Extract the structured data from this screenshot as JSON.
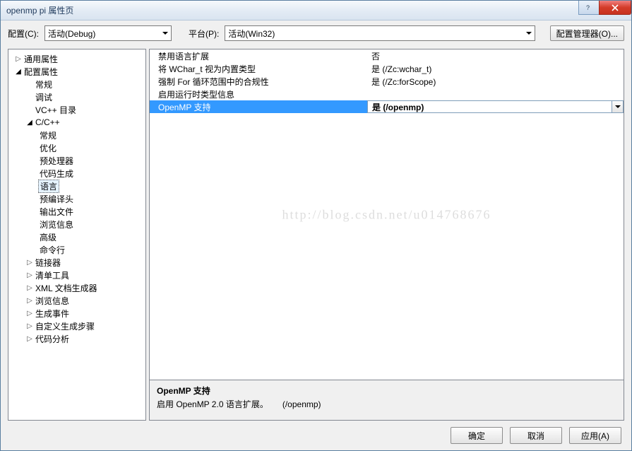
{
  "window": {
    "title": "openmp pi 属性页"
  },
  "toolbar": {
    "config_label": "配置(C):",
    "config_value": "活动(Debug)",
    "platform_label": "平台(P):",
    "platform_value": "活动(Win32)",
    "manager_button": "配置管理器(O)..."
  },
  "tree": {
    "general": "通用属性",
    "config_props": "配置属性",
    "cfg": {
      "general": "常规",
      "debug": "调试",
      "vcdirs": "VC++ 目录",
      "ccpp": "C/C++",
      "ccpp_children": {
        "general": "常规",
        "optimize": "优化",
        "preproc": "预处理器",
        "codegen": "代码生成",
        "language": "语言",
        "pch": "预编译头",
        "outfiles": "输出文件",
        "browse": "浏览信息",
        "advanced": "高级",
        "cmdline": "命令行"
      },
      "linker": "链接器",
      "manifest": "清单工具",
      "xmldoc": "XML 文档生成器",
      "browseinfo": "浏览信息",
      "buildevents": "生成事件",
      "custombuild": "自定义生成步骤",
      "codeanalysis": "代码分析"
    }
  },
  "grid": {
    "rows": [
      {
        "name": "禁用语言扩展",
        "value": "否"
      },
      {
        "name": "将 WChar_t 视为内置类型",
        "value": "是 (/Zc:wchar_t)"
      },
      {
        "name": "强制 For 循环范围中的合规性",
        "value": "是 (/Zc:forScope)"
      },
      {
        "name": "启用运行时类型信息",
        "value": ""
      },
      {
        "name": "OpenMP 支持",
        "value": "是 (/openmp)",
        "selected": true
      }
    ],
    "watermark": "http://blog.csdn.net/u014768676"
  },
  "desc": {
    "title": "OpenMP 支持",
    "text": "启用 OpenMP 2.0 语言扩展。",
    "switch": "(/openmp)"
  },
  "buttons": {
    "ok": "确定",
    "cancel": "取消",
    "apply": "应用(A)"
  }
}
